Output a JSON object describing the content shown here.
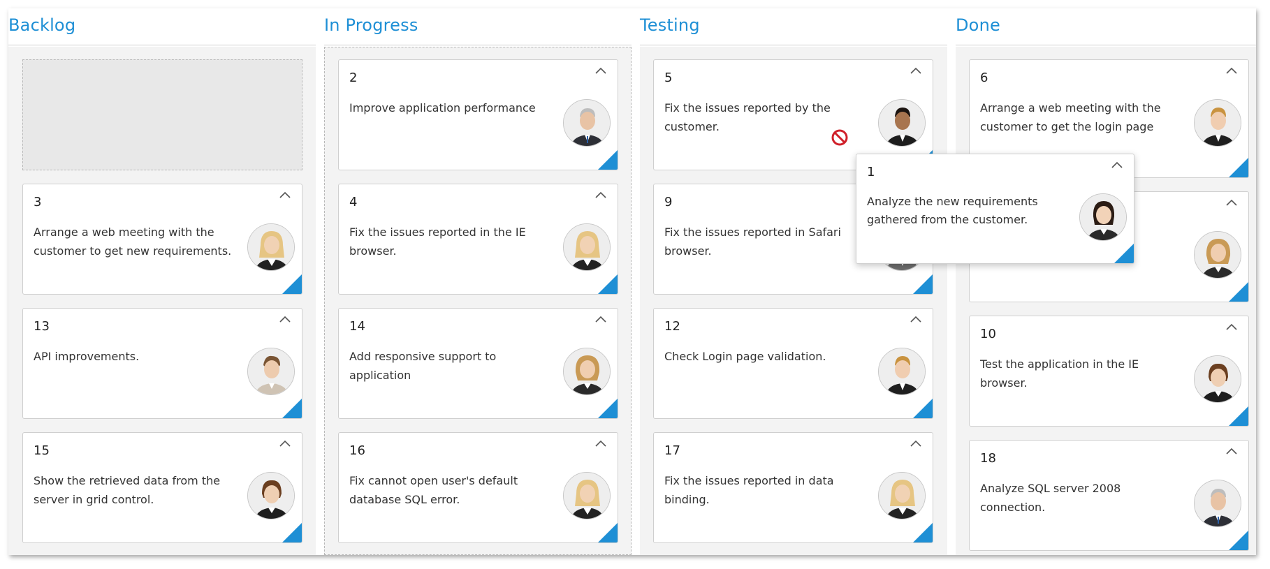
{
  "board": {
    "columns": [
      {
        "title": "Backlog",
        "cards": [
          {
            "id": "3",
            "text": "Arrange a web meeting with the customer to get new requirements.",
            "avatar": "woman-blonde"
          },
          {
            "id": "13",
            "text": "API improvements.",
            "avatar": "man-young"
          },
          {
            "id": "15",
            "text": "Show the retrieved data from the server in grid control.",
            "avatar": "woman-dark"
          }
        ]
      },
      {
        "title": "In Progress",
        "cards": [
          {
            "id": "2",
            "text": "Improve application performance",
            "avatar": "man-grey"
          },
          {
            "id": "4",
            "text": "Fix the issues reported in the IE browser.",
            "avatar": "woman-blonde"
          },
          {
            "id": "14",
            "text": "Add responsive support to application",
            "avatar": "woman-curly"
          },
          {
            "id": "16",
            "text": "Fix cannot open user's default database SQL error.",
            "avatar": "woman-blonde"
          }
        ]
      },
      {
        "title": "Testing",
        "cards": [
          {
            "id": "5",
            "text": "Fix the issues reported by the customer.",
            "avatar": "man-dark"
          },
          {
            "id": "9",
            "text": "Fix the issues reported in Safari browser.",
            "avatar": "man-grey"
          },
          {
            "id": "12",
            "text": "Check Login page validation.",
            "avatar": "man-blonde"
          },
          {
            "id": "17",
            "text": "Fix the issues reported in data binding.",
            "avatar": "woman-blonde"
          }
        ]
      },
      {
        "title": "Done",
        "cards": [
          {
            "id": "6",
            "text": "Arrange a web meeting with the customer to get the login page",
            "avatar": "man-blonde"
          },
          {
            "id": "",
            "text": "",
            "avatar": "woman-curly"
          },
          {
            "id": "10",
            "text": "Test the application in the IE browser.",
            "avatar": "woman-dark"
          },
          {
            "id": "18",
            "text": "Analyze SQL server 2008 connection.",
            "avatar": "man-grey"
          }
        ]
      }
    ]
  },
  "dragging": {
    "id": "1",
    "text": "Analyze the new requirements gathered from the customer.",
    "avatar": "woman-dark-hair"
  },
  "colors": {
    "accent": "#1e8fd5",
    "card_border": "#cfcfcf",
    "column_bg": "#f3f3f3",
    "no_drop": "#d0202a"
  }
}
